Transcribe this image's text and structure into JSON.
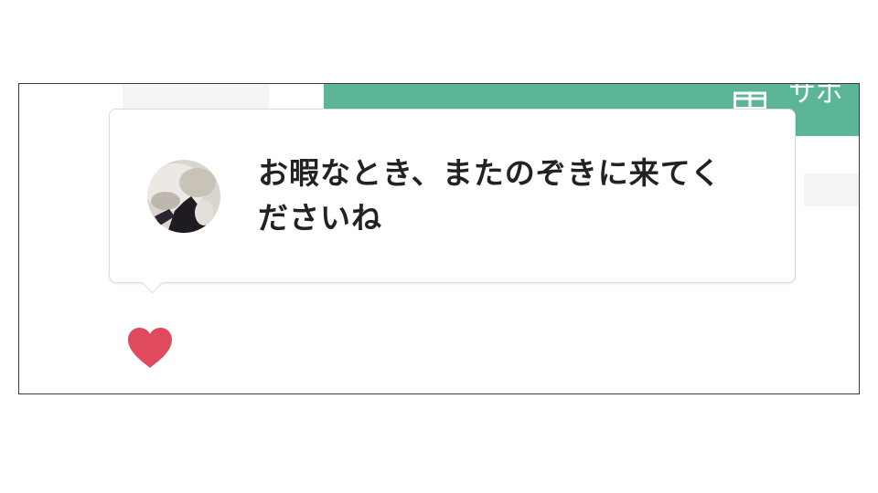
{
  "header": {
    "support_button_label": "サポ",
    "gift_icon": "gift-icon",
    "accent_color": "#5db598"
  },
  "tooltip": {
    "message_line1": "お暇なとき、またのぞきに来てく",
    "message_line2": "ださいね",
    "avatar": "user-avatar"
  },
  "reaction": {
    "icon": "heart-icon",
    "color": "#e04a5f"
  }
}
